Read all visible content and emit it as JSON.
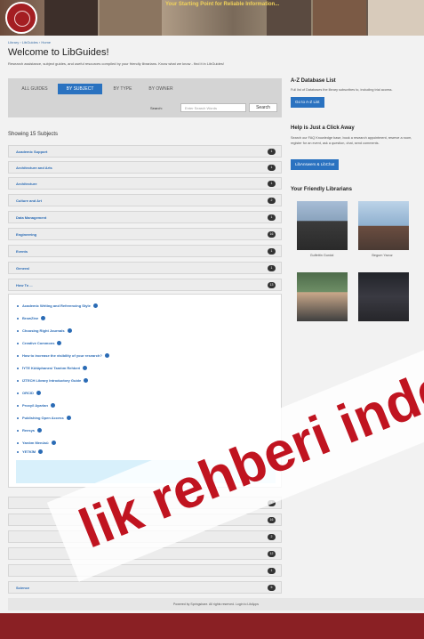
{
  "banner": {
    "tagline": "Your Starting Point for Reliable Information..."
  },
  "breadcrumb": "Library › LibGuides › Home",
  "page": {
    "title": "Welcome to LibGuides!",
    "subtitle": "Research assistance, subject guides, and useful resources compiled by your friendly librarians. Know what we know - find it in LibGuides!"
  },
  "tabs": [
    "ALL GUIDES",
    "BY SUBJECT",
    "BY TYPE",
    "BY OWNER"
  ],
  "search": {
    "label": "Search:",
    "placeholder": "Enter Search Words",
    "button": "Search"
  },
  "showing": "Showing 15 Subjects",
  "subjects": [
    {
      "name": "Academic Support",
      "count": "1"
    },
    {
      "name": "Architecture and Arts",
      "count": "1"
    },
    {
      "name": "Architecture",
      "count": "1"
    },
    {
      "name": "Culture and Art",
      "count": "2"
    },
    {
      "name": "Data Management",
      "count": "1"
    },
    {
      "name": "Engineering",
      "count": "16"
    },
    {
      "name": "Events",
      "count": "1"
    },
    {
      "name": "General",
      "count": "1"
    },
    {
      "name": "How To ...",
      "count": "13"
    }
  ],
  "howto_guides": [
    "Academic Writing and Referencing Style",
    "BrowZine",
    "Choosing Right Journals",
    "Creative Commons",
    "How to increase the visibility of your research?",
    "İYTE Kütüphanesi Tanıtım Rehberi",
    "IZTECH Library Introductory Guide",
    "ORCID",
    "Proxy/I Ayarları",
    "Publishing Open Access",
    "Reesys",
    "Yardım Menüsü",
    "YETKİM"
  ],
  "subjects_after": [
    {
      "name": "",
      "count": "1"
    },
    {
      "name": "",
      "count": "16"
    },
    {
      "name": "",
      "count": "2"
    },
    {
      "name": "",
      "count": "12"
    },
    {
      "name": "",
      "count": "1"
    },
    {
      "name": "Science",
      "count": "5"
    }
  ],
  "sidebar": {
    "az_title": "A-Z Database List",
    "az_text": "Full list of Databases the library subscribes to, including trial access.",
    "az_button": "Go to A-Z List",
    "click_title": "Help is Just a Click Away",
    "click_text": "Search our FAQ Knowledge base, book a research appointment, reserve a room, register for an event, ask a question, chat, send comments.",
    "click_button": "LibAnswers & LibChat",
    "librarians_title": "Your Friendly Librarians",
    "librarians": [
      "Gulfettin Gurdal",
      "Begum Yavuz"
    ]
  },
  "footer": "Powered by Springshare.  All rights reserved.  Login to LibApps",
  "watermark": "lik rehberi indeks",
  "colors": {
    "accent": "#2a72c0",
    "brand": "#8a2024",
    "watermark": "#c01420"
  }
}
